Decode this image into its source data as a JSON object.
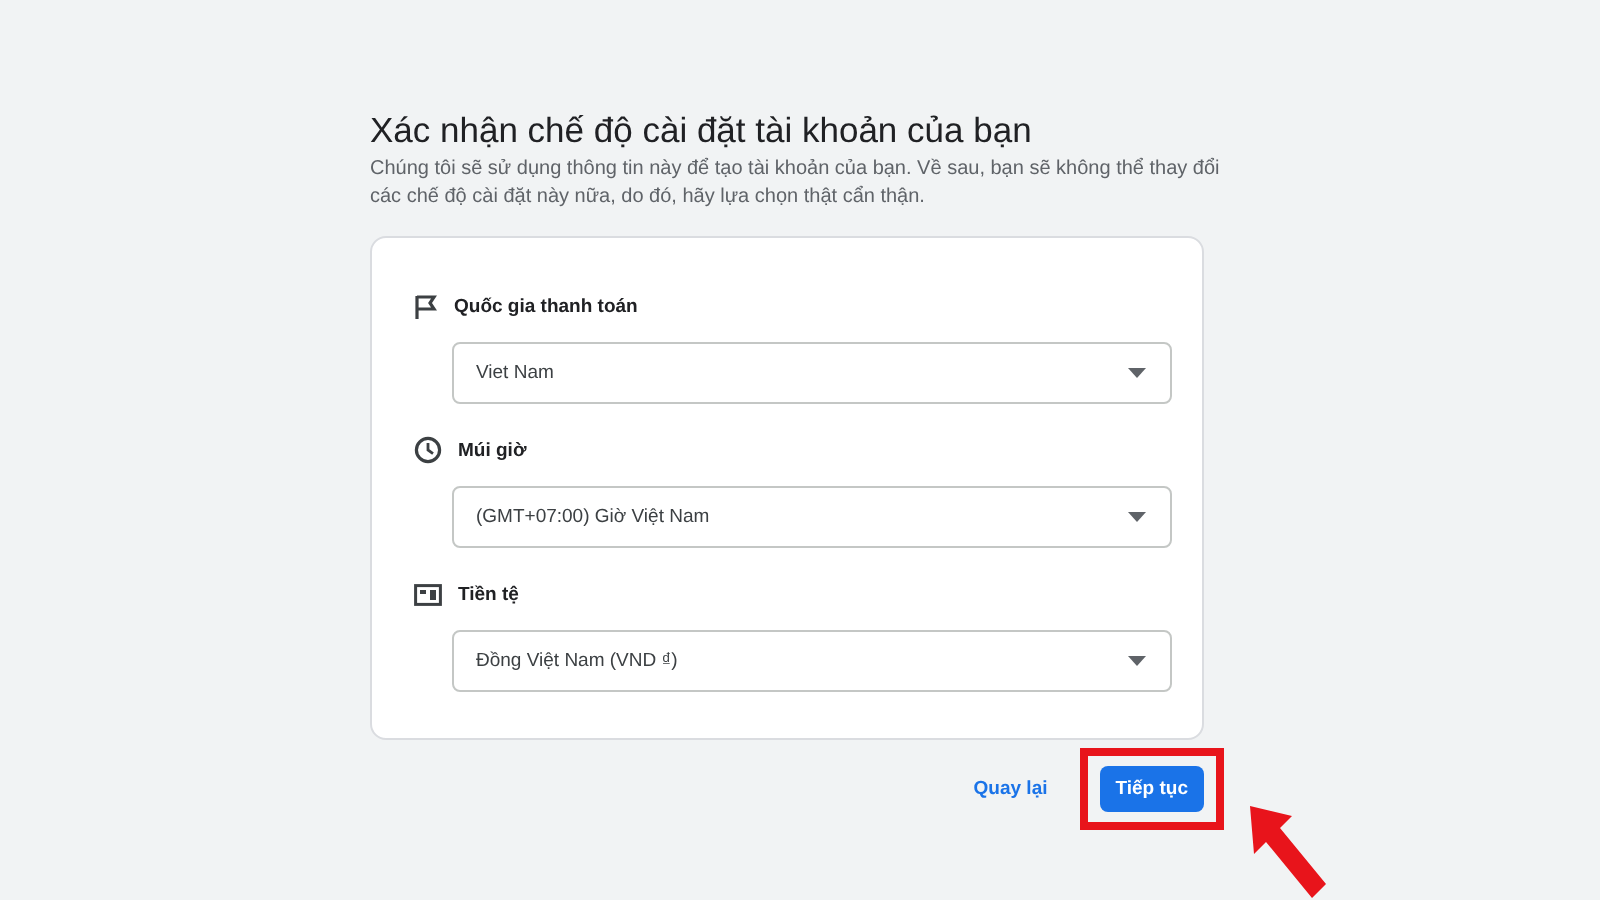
{
  "title": "Xác nhận chế độ cài đặt tài khoản của bạn",
  "description": "Chúng tôi sẽ sử dụng thông tin này để tạo tài khoản của bạn. Về sau, bạn sẽ không thể thay đổi các chế độ cài đặt này nữa, do đó, hãy lựa chọn thật cẩn thận.",
  "fields": [
    {
      "label": "Quốc gia thanh toán",
      "value": "Viet Nam"
    },
    {
      "label": "Múi giờ",
      "value": "(GMT+07:00) Giờ Việt Nam"
    },
    {
      "label": "Tiền tệ",
      "value": "Đồng Việt Nam (VND ₫)"
    }
  ],
  "buttons": [
    {
      "label": "Quay lại",
      "kind": "text"
    },
    {
      "label": "Tiếp tục",
      "kind": "primary"
    }
  ]
}
